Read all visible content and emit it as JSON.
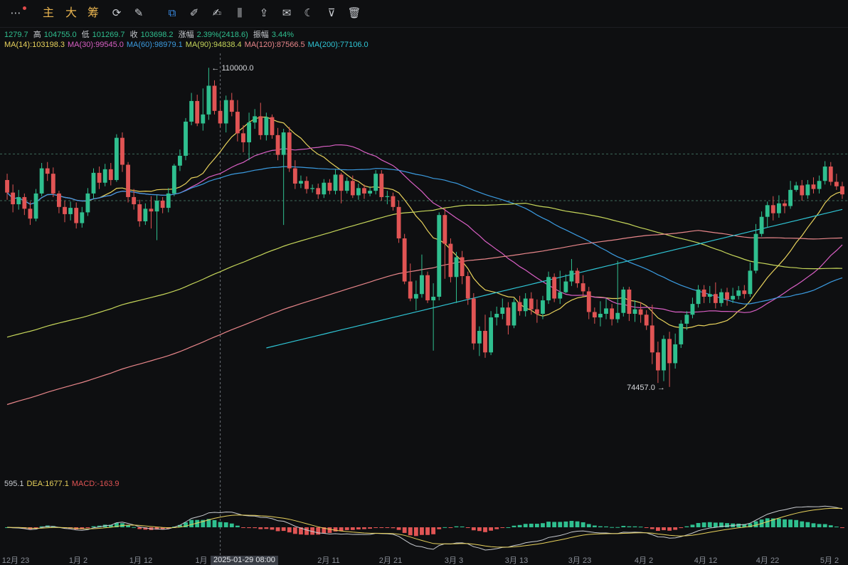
{
  "toolbar": {
    "items": [
      {
        "name": "more-icon",
        "glyph": "⋯"
      },
      {
        "name": "main-chart-button",
        "label": "主"
      },
      {
        "name": "large-button",
        "label": "大"
      },
      {
        "name": "chip-button",
        "label": "筹"
      },
      {
        "name": "refresh-icon",
        "glyph": "⟳"
      },
      {
        "name": "draw-line-icon",
        "glyph": "✎"
      },
      {
        "name": "copy-icon",
        "glyph": "⧉"
      },
      {
        "name": "ruler-icon",
        "glyph": "✐"
      },
      {
        "name": "pen-icon",
        "glyph": "✍"
      },
      {
        "name": "candle-icon",
        "glyph": "⫼"
      },
      {
        "name": "export-icon",
        "glyph": "⇪"
      },
      {
        "name": "note-icon",
        "glyph": "✉"
      },
      {
        "name": "magnet-icon",
        "glyph": "☾"
      },
      {
        "name": "filter-icon",
        "glyph": "⊽"
      },
      {
        "name": "trash-icon",
        "glyph": "🗑"
      }
    ]
  },
  "stats": {
    "open": "1279.7",
    "high_label": "高",
    "high": "104755.0",
    "low_label": "低",
    "low": "101269.7",
    "close_label": "收",
    "close": "103698.2",
    "change_label": "涨幅",
    "change": "2.39%(2418.6)",
    "amp_label": "振幅",
    "amp": "3.44%"
  },
  "ma_legend": [
    {
      "label": "MA(14):103198.3",
      "color": "#e8d25c"
    },
    {
      "label": "MA(30):99545.0",
      "color": "#d95fc4"
    },
    {
      "label": "MA(60):98979.1",
      "color": "#3b9be0"
    },
    {
      "label": "MA(90):94838.4",
      "color": "#c6d65a"
    },
    {
      "label": "MA(120):87566.5",
      "color": "#e8868a"
    },
    {
      "label": "MA(200):77106.0",
      "color": "#2fc6d6"
    }
  ],
  "macd_legend": [
    {
      "label": "595.1",
      "color": "#c9ccd1"
    },
    {
      "label": "DEA:1677.1",
      "color": "#e8d25c"
    },
    {
      "label": "MACD:-163.9",
      "color": "#e05454"
    }
  ],
  "annotations": {
    "high_mark": "110000.0",
    "low_mark": "74457.0"
  },
  "cursor_label": "2025-01-29 08:00",
  "colors": {
    "up": "#2fbf8f",
    "down": "#e05454",
    "background": "#0e0f11"
  },
  "chart_data": {
    "type": "candlestick",
    "x_ticks": [
      "12月 23",
      "1月 2",
      "1月 12",
      "1月",
      "2月 11",
      "2月 21",
      "3月 3",
      "3月 13",
      "3月 23",
      "4月 2",
      "4月 12",
      "4月 22",
      "5月 2"
    ],
    "ylim": [
      70000,
      112000
    ],
    "reference_lines": [
      100400,
      95200
    ],
    "candles": [
      [
        97500,
        96100,
        98200,
        95300
      ],
      [
        96100,
        94800,
        97000,
        93900
      ],
      [
        94800,
        95600,
        96400,
        94200
      ],
      [
        95600,
        94300,
        96000,
        93600
      ],
      [
        94300,
        93200,
        95100,
        92500
      ],
      [
        93200,
        96000,
        96500,
        92900
      ],
      [
        96000,
        98800,
        99400,
        95700
      ],
      [
        98800,
        98200,
        99500,
        97400
      ],
      [
        98200,
        96000,
        98900,
        95600
      ],
      [
        96000,
        94500,
        96300,
        93800
      ],
      [
        94500,
        93700,
        95200,
        92800
      ],
      [
        93700,
        94400,
        95100,
        93000
      ],
      [
        94400,
        92700,
        95000,
        92100
      ],
      [
        92700,
        93900,
        94500,
        92200
      ],
      [
        93900,
        96000,
        96600,
        93500
      ],
      [
        96000,
        98300,
        98800,
        95400
      ],
      [
        98300,
        97200,
        99000,
        96500
      ],
      [
        97200,
        98700,
        99300,
        96800
      ],
      [
        98700,
        97500,
        99400,
        96900
      ],
      [
        97500,
        102200,
        102600,
        97300
      ],
      [
        102200,
        99200,
        102800,
        98400
      ],
      [
        99200,
        95600,
        99500,
        95000
      ],
      [
        95600,
        94800,
        96500,
        94200
      ],
      [
        94800,
        92900,
        95300,
        92300
      ],
      [
        92900,
        94300,
        94900,
        92500
      ],
      [
        94300,
        94000,
        95700,
        92100
      ],
      [
        94000,
        95200,
        95800,
        90800
      ],
      [
        95200,
        94400,
        95600,
        93800
      ],
      [
        94400,
        96000,
        96600,
        93900
      ],
      [
        96000,
        99100,
        99300,
        95700
      ],
      [
        99100,
        100200,
        100900,
        98500
      ],
      [
        100200,
        104000,
        104400,
        99700
      ],
      [
        104000,
        106300,
        107200,
        103600
      ],
      [
        106300,
        103800,
        107000,
        103500
      ],
      [
        103800,
        104800,
        107700,
        103000
      ],
      [
        104800,
        108000,
        110000,
        104200
      ],
      [
        108000,
        105200,
        108600,
        104800
      ],
      [
        105200,
        103800,
        106300,
        103400
      ],
      [
        103800,
        106400,
        106900,
        102800
      ],
      [
        106400,
        105100,
        107200,
        104600
      ],
      [
        105100,
        102700,
        106400,
        101800
      ],
      [
        102700,
        101700,
        103600,
        100600
      ],
      [
        101700,
        103900,
        105000,
        99700
      ],
      [
        103900,
        104600,
        105400,
        103200
      ],
      [
        104600,
        102500,
        106100,
        102000
      ],
      [
        102500,
        104500,
        105000,
        101900
      ],
      [
        104500,
        102500,
        104800,
        102100
      ],
      [
        102500,
        100300,
        103300,
        99700
      ],
      [
        100300,
        102800,
        103200,
        92500
      ],
      [
        102800,
        98800,
        103400,
        98400
      ],
      [
        98800,
        97100,
        99700,
        96500
      ],
      [
        97100,
        97400,
        98000,
        96600
      ],
      [
        97400,
        96500,
        97900,
        96000
      ],
      [
        96500,
        96600,
        97000,
        96100
      ],
      [
        96600,
        95900,
        97100,
        95400
      ],
      [
        95900,
        97200,
        97600,
        95500
      ],
      [
        97200,
        96300,
        97600,
        95900
      ],
      [
        96300,
        98100,
        98700,
        95900
      ],
      [
        98100,
        96300,
        98300,
        94900
      ],
      [
        96300,
        97400,
        97800,
        96000
      ],
      [
        97400,
        95800,
        98000,
        95500
      ],
      [
        95800,
        96600,
        97100,
        95300
      ],
      [
        96600,
        96000,
        97000,
        95400
      ],
      [
        96000,
        96300,
        96800,
        95700
      ],
      [
        96300,
        98200,
        98600,
        95900
      ],
      [
        98200,
        95600,
        98600,
        95200
      ],
      [
        95600,
        95700,
        96300,
        94800
      ],
      [
        95700,
        94500,
        96100,
        94100
      ],
      [
        94500,
        91000,
        95200,
        90500
      ],
      [
        91000,
        86200,
        91500,
        85900
      ],
      [
        86200,
        84300,
        88200,
        84000
      ],
      [
        84300,
        84800,
        86300,
        83000
      ],
      [
        84800,
        86900,
        89200,
        84400
      ],
      [
        86900,
        84100,
        87300,
        83800
      ],
      [
        84100,
        84500,
        86000,
        78500
      ],
      [
        84500,
        93600,
        93900,
        84100
      ],
      [
        93600,
        90400,
        94400,
        86500
      ],
      [
        90400,
        86700,
        91000,
        86100
      ],
      [
        86700,
        88900,
        89500,
        83800
      ],
      [
        88900,
        86800,
        89600,
        85900
      ],
      [
        86800,
        84300,
        87300,
        83600
      ],
      [
        84300,
        79300,
        84900,
        78600
      ],
      [
        79300,
        80700,
        81200,
        77900
      ],
      [
        80700,
        78300,
        82500,
        77700
      ],
      [
        78300,
        82200,
        82900,
        78000
      ],
      [
        82200,
        82600,
        83400,
        81300
      ],
      [
        82600,
        83300,
        84300,
        82000
      ],
      [
        83300,
        81300,
        83900,
        80300
      ],
      [
        81300,
        83900,
        84300,
        81000
      ],
      [
        83900,
        82900,
        84600,
        82400
      ],
      [
        82900,
        84300,
        84900,
        82300
      ],
      [
        84300,
        83100,
        85000,
        82500
      ],
      [
        83100,
        82600,
        84200,
        81600
      ],
      [
        82600,
        84100,
        84600,
        82000
      ],
      [
        84100,
        86700,
        87300,
        83700
      ],
      [
        86700,
        84300,
        87100,
        83900
      ],
      [
        84300,
        85000,
        87400,
        83700
      ],
      [
        85000,
        86200,
        87000,
        84900
      ],
      [
        86200,
        87400,
        88700,
        85700
      ],
      [
        87400,
        86000,
        87700,
        85500
      ],
      [
        86000,
        85100,
        86900,
        84500
      ],
      [
        85100,
        82800,
        85600,
        82000
      ],
      [
        82800,
        82200,
        83300,
        81500
      ],
      [
        82200,
        82600,
        84000,
        81200
      ],
      [
        82600,
        83200,
        84300,
        82000
      ],
      [
        83200,
        82000,
        83700,
        81300
      ],
      [
        82000,
        82700,
        88500,
        81600
      ],
      [
        82700,
        85300,
        85600,
        82300
      ],
      [
        85300,
        82600,
        85600,
        81800
      ],
      [
        82600,
        83100,
        84100,
        81700
      ],
      [
        83100,
        82500,
        83900,
        81600
      ],
      [
        82500,
        81300,
        83000,
        80800
      ],
      [
        81300,
        78300,
        83600,
        77000
      ],
      [
        78300,
        76300,
        79500,
        74900
      ],
      [
        76300,
        79800,
        80200,
        75100
      ],
      [
        79800,
        77100,
        80600,
        74457
      ],
      [
        77100,
        79200,
        80400,
        76500
      ],
      [
        79200,
        81500,
        81900,
        78800
      ],
      [
        81500,
        82500,
        82900,
        80800
      ],
      [
        82500,
        83700,
        84400,
        82100
      ],
      [
        83700,
        85300,
        85800,
        83300
      ],
      [
        85300,
        84500,
        85800,
        83800
      ],
      [
        84500,
        84800,
        85700,
        83800
      ],
      [
        84800,
        83800,
        86100,
        83200
      ],
      [
        83800,
        85000,
        85400,
        83400
      ],
      [
        85000,
        84200,
        85500,
        83500
      ],
      [
        84200,
        84600,
        85500,
        83800
      ],
      [
        84600,
        85200,
        85700,
        84200
      ],
      [
        85200,
        84800,
        85800,
        84300
      ],
      [
        84800,
        87400,
        88300,
        84500
      ],
      [
        87400,
        91500,
        92600,
        87100
      ],
      [
        91500,
        93400,
        94000,
        91200
      ],
      [
        93400,
        94700,
        95100,
        92200
      ],
      [
        94700,
        93800,
        95700,
        93000
      ],
      [
        93800,
        94900,
        95800,
        93300
      ],
      [
        94900,
        94600,
        95300,
        93800
      ],
      [
        94600,
        96400,
        97400,
        94300
      ],
      [
        96400,
        96900,
        97300,
        96200
      ],
      [
        96900,
        95800,
        97500,
        95200
      ],
      [
        95800,
        97000,
        97500,
        95400
      ],
      [
        97000,
        96500,
        97800,
        96000
      ],
      [
        96500,
        97400,
        98000,
        96000
      ],
      [
        97400,
        99000,
        99600,
        97000
      ],
      [
        99000,
        97300,
        99500,
        96900
      ],
      [
        97300,
        96800,
        98200,
        96400
      ],
      [
        96800,
        95900,
        97300,
        95400
      ]
    ],
    "macd_series": {
      "dif_name": "DIF",
      "dea_name": "DEA",
      "macd_name": "MACD"
    }
  }
}
